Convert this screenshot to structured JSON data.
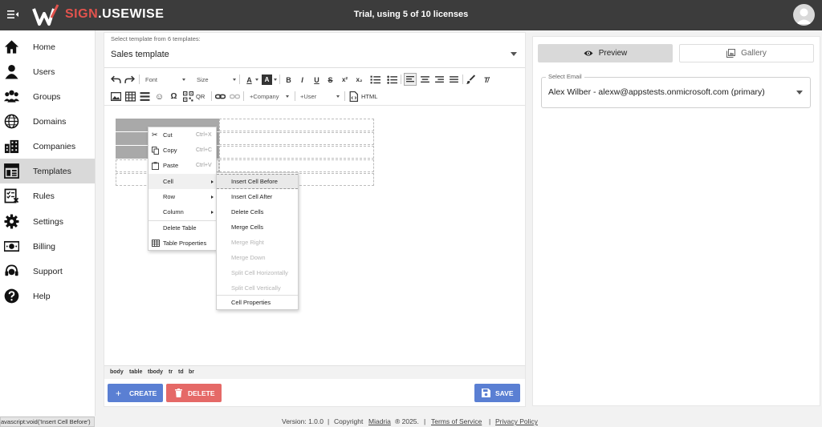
{
  "header": {
    "brand_part1": "SIGN",
    "brand_part2": ".USEWISE",
    "trial_text": "Trial, using 5 of 10 licenses"
  },
  "sidebar": {
    "items": [
      {
        "label": "Home",
        "icon": "home-icon"
      },
      {
        "label": "Users",
        "icon": "user-icon"
      },
      {
        "label": "Groups",
        "icon": "groups-icon"
      },
      {
        "label": "Domains",
        "icon": "globe-icon"
      },
      {
        "label": "Companies",
        "icon": "building-icon"
      },
      {
        "label": "Templates",
        "icon": "templates-icon"
      },
      {
        "label": "Rules",
        "icon": "rules-icon"
      },
      {
        "label": "Settings",
        "icon": "gear-icon"
      },
      {
        "label": "Billing",
        "icon": "money-icon"
      },
      {
        "label": "Support",
        "icon": "headset-icon"
      },
      {
        "label": "Help",
        "icon": "help-icon"
      }
    ],
    "active": "Templates"
  },
  "template_select": {
    "label": "Select template from 6 templates:",
    "value": "Sales template"
  },
  "toolbar": {
    "font_label": "Font",
    "size_label": "Size",
    "company_label": "+Company",
    "user_label": "+User",
    "qr_label": "QR",
    "html_label": "HTML"
  },
  "context_menu": {
    "items": [
      {
        "label": "Cut",
        "shortcut": "Ctrl+X"
      },
      {
        "label": "Copy",
        "shortcut": "Ctrl+C"
      },
      {
        "label": "Paste",
        "shortcut": "Ctrl+V"
      },
      {
        "label": "Cell"
      },
      {
        "label": "Row"
      },
      {
        "label": "Column"
      },
      {
        "label": "Delete Table"
      },
      {
        "label": "Table Properties"
      }
    ]
  },
  "cell_submenu": {
    "items": [
      {
        "label": "Insert Cell Before",
        "enabled": true
      },
      {
        "label": "Insert Cell After",
        "enabled": true
      },
      {
        "label": "Delete Cells",
        "enabled": true
      },
      {
        "label": "Merge Cells",
        "enabled": true
      },
      {
        "label": "Merge Right",
        "enabled": false
      },
      {
        "label": "Merge Down",
        "enabled": false
      },
      {
        "label": "Split Cell Horizontally",
        "enabled": false
      },
      {
        "label": "Split Cell Vertically",
        "enabled": false
      },
      {
        "label": "Cell Properties",
        "enabled": true
      }
    ]
  },
  "element_path": [
    "body",
    "table",
    "tbody",
    "tr",
    "td",
    "br"
  ],
  "buttons": {
    "create": "CREATE",
    "delete": "DELETE",
    "save": "SAVE"
  },
  "preview": {
    "tab_preview": "Preview",
    "tab_gallery": "Gallery",
    "email_label": "Select Email",
    "email_value": "Alex Wilber - alexw@appstests.onmicrosoft.com (primary)"
  },
  "footer": {
    "version": "Version: 1.0.0",
    "copyright_prefix": "Copyright",
    "company": "Miadria",
    "copyright_suffix": "® 2025.",
    "terms": "Terms of Service",
    "privacy": "Privacy Policy",
    "sep": "|",
    "status_url": "avascript:void('Insert Cell Before')"
  },
  "colors": {
    "topbar": "#3c3c3c",
    "brand_red": "#e2534d",
    "primary_blue": "#5a7fd3",
    "danger_red": "#e56967"
  }
}
